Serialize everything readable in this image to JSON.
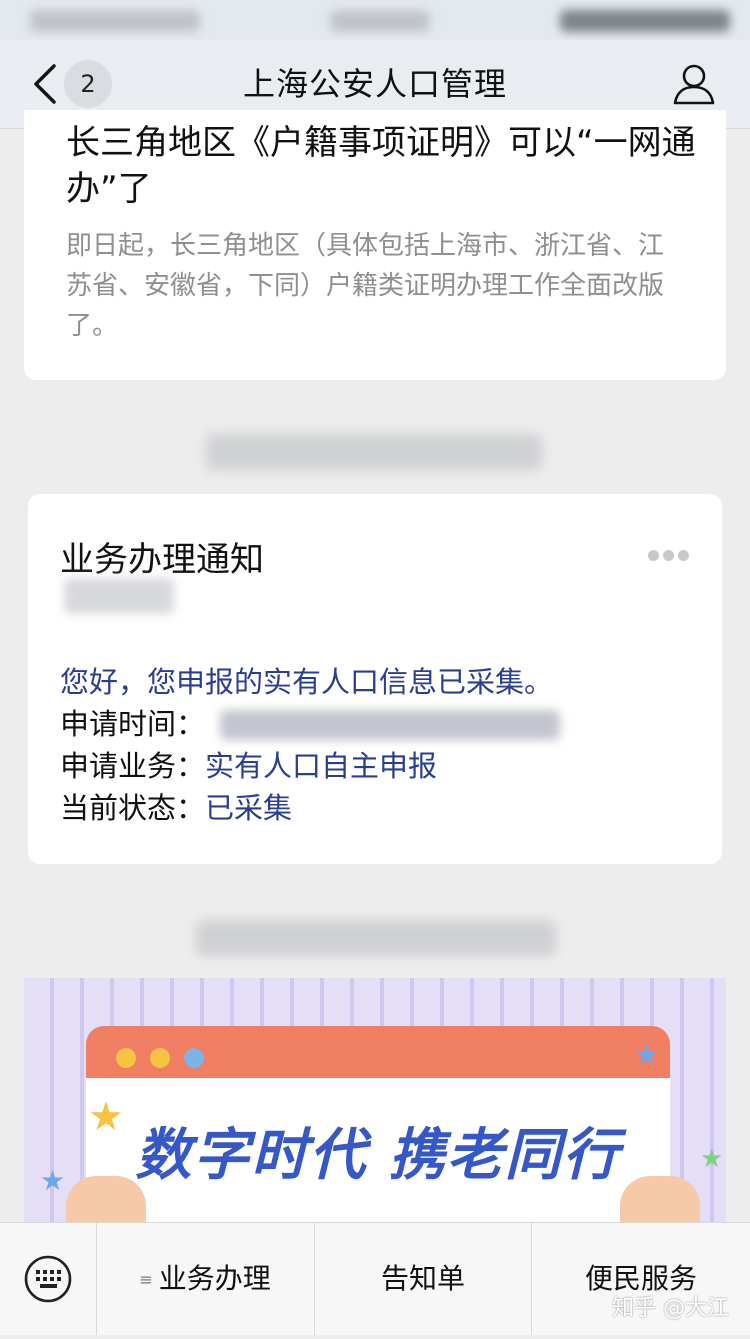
{
  "nav": {
    "title": "上海公安人口管理",
    "unread_count": "2"
  },
  "article": {
    "title": "长三角地区《户籍事项证明》可以“一网通办”了",
    "summary": "即日起，长三角地区（具体包括上海市、浙江省、江苏省、安徽省，下同）户籍类证明办理工作全面改版了。"
  },
  "notice": {
    "title": "业务办理通知",
    "greeting": "您好，您申报的实有人口信息已采集。",
    "apply_time_label": "申请时间：",
    "apply_business_label": "申请业务：",
    "apply_business_value": "实有人口自主申报",
    "status_label": "当前状态：",
    "status_value": "已采集"
  },
  "banner": {
    "text": "数字时代 携老同行"
  },
  "menu": {
    "items": [
      {
        "prefix": "≡",
        "label": "业务办理"
      },
      {
        "label": "告知单"
      },
      {
        "label": "便民服务"
      }
    ]
  },
  "watermark": "知乎 @大江",
  "colors": {
    "accent_blue": "#2a3e8f",
    "banner_text": "#3657c7",
    "window_header": "#f07e62"
  }
}
